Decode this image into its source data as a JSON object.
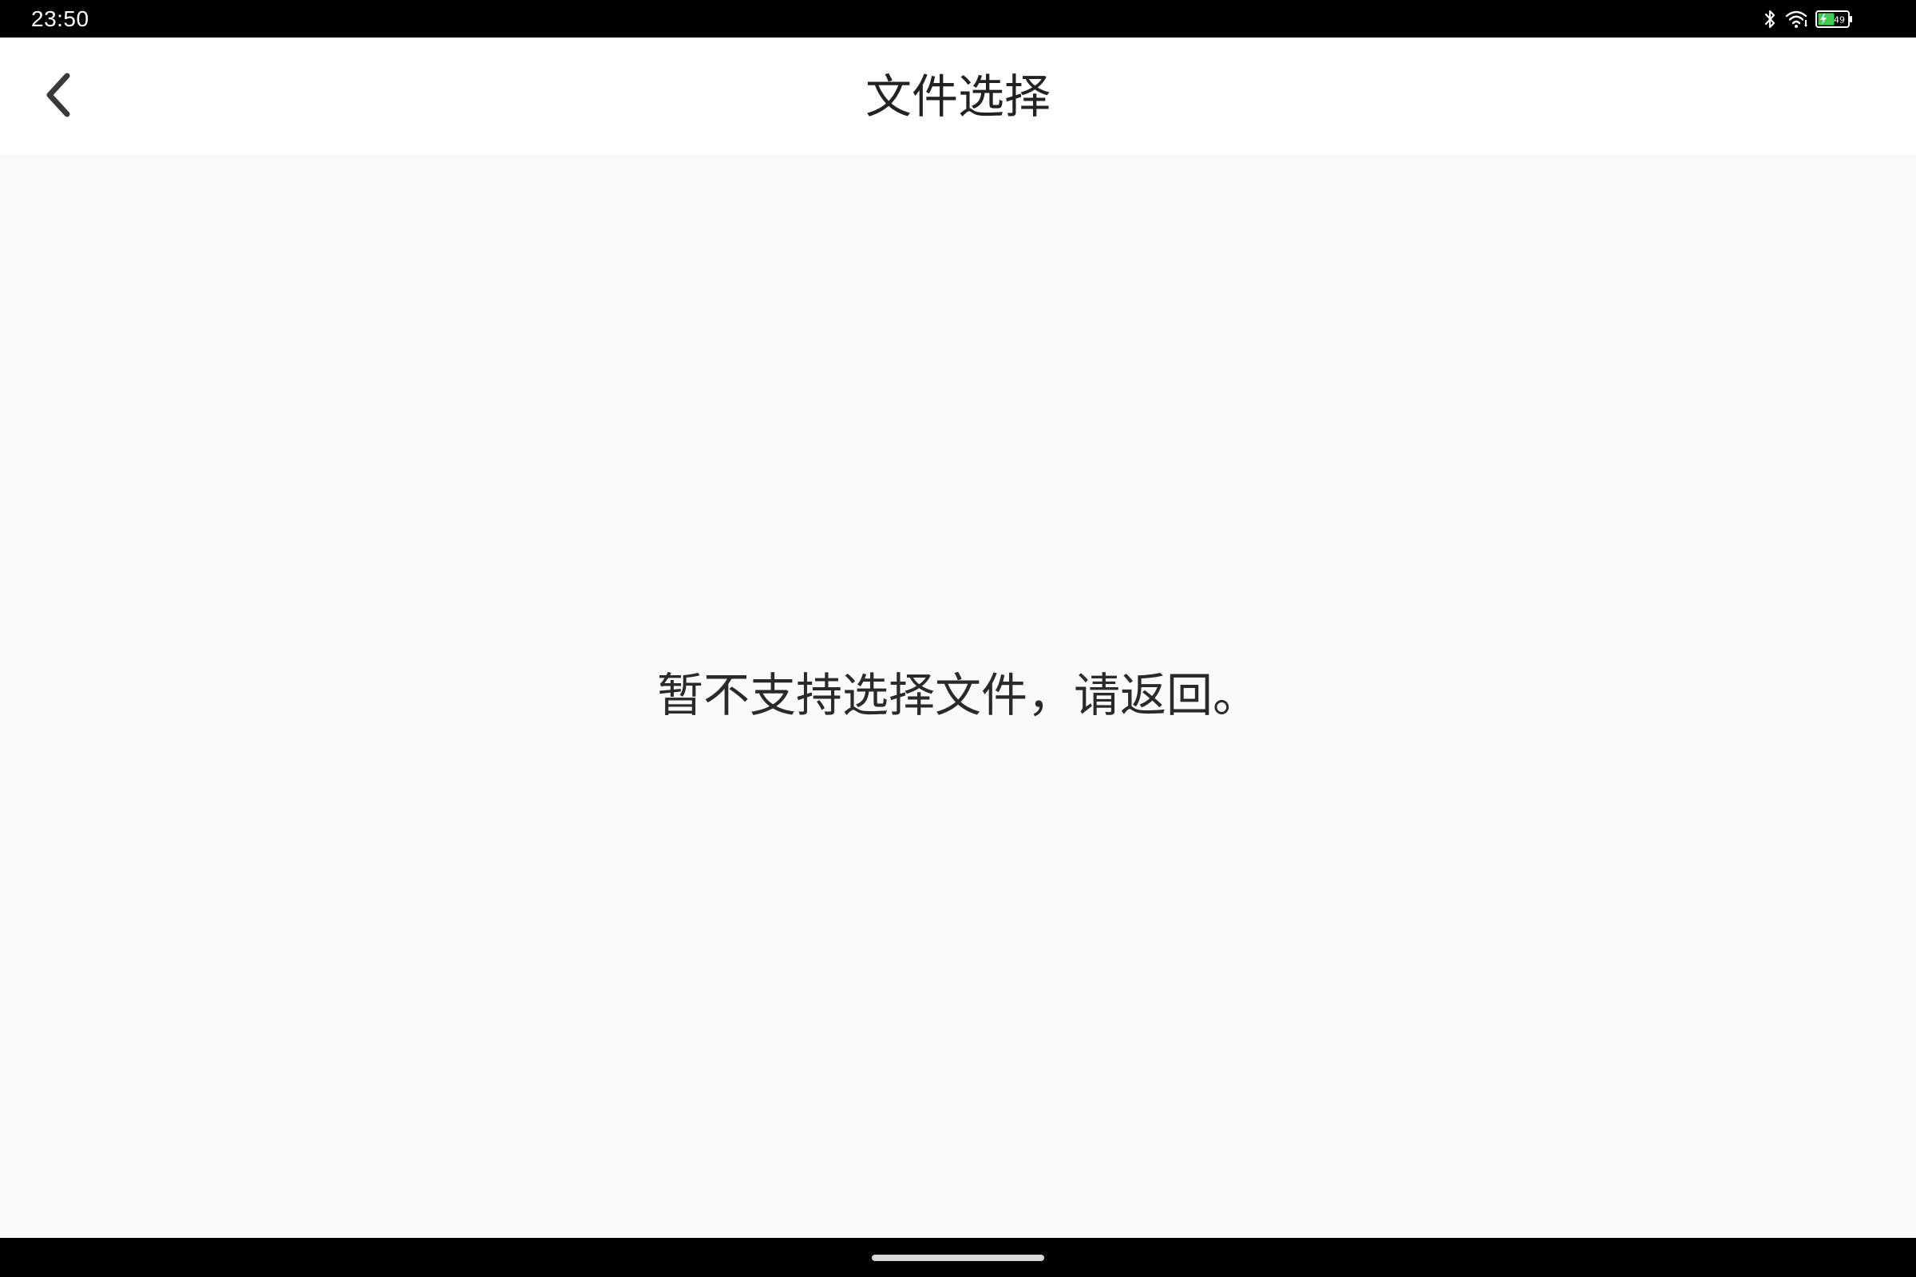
{
  "status_bar": {
    "time": "23:50",
    "battery_level": "49",
    "icons": [
      "bluetooth-icon",
      "wifi-icon",
      "battery-charging-icon"
    ]
  },
  "app_bar": {
    "title": "文件选择",
    "back_icon": "chevron-left-icon"
  },
  "content": {
    "message": "暂不支持选择文件，请返回。"
  },
  "colors": {
    "status_bar_bg": "#000000",
    "app_bar_bg": "#ffffff",
    "content_bg": "#fafafa",
    "text": "#222222",
    "battery_fill": "#3ccf4e"
  }
}
